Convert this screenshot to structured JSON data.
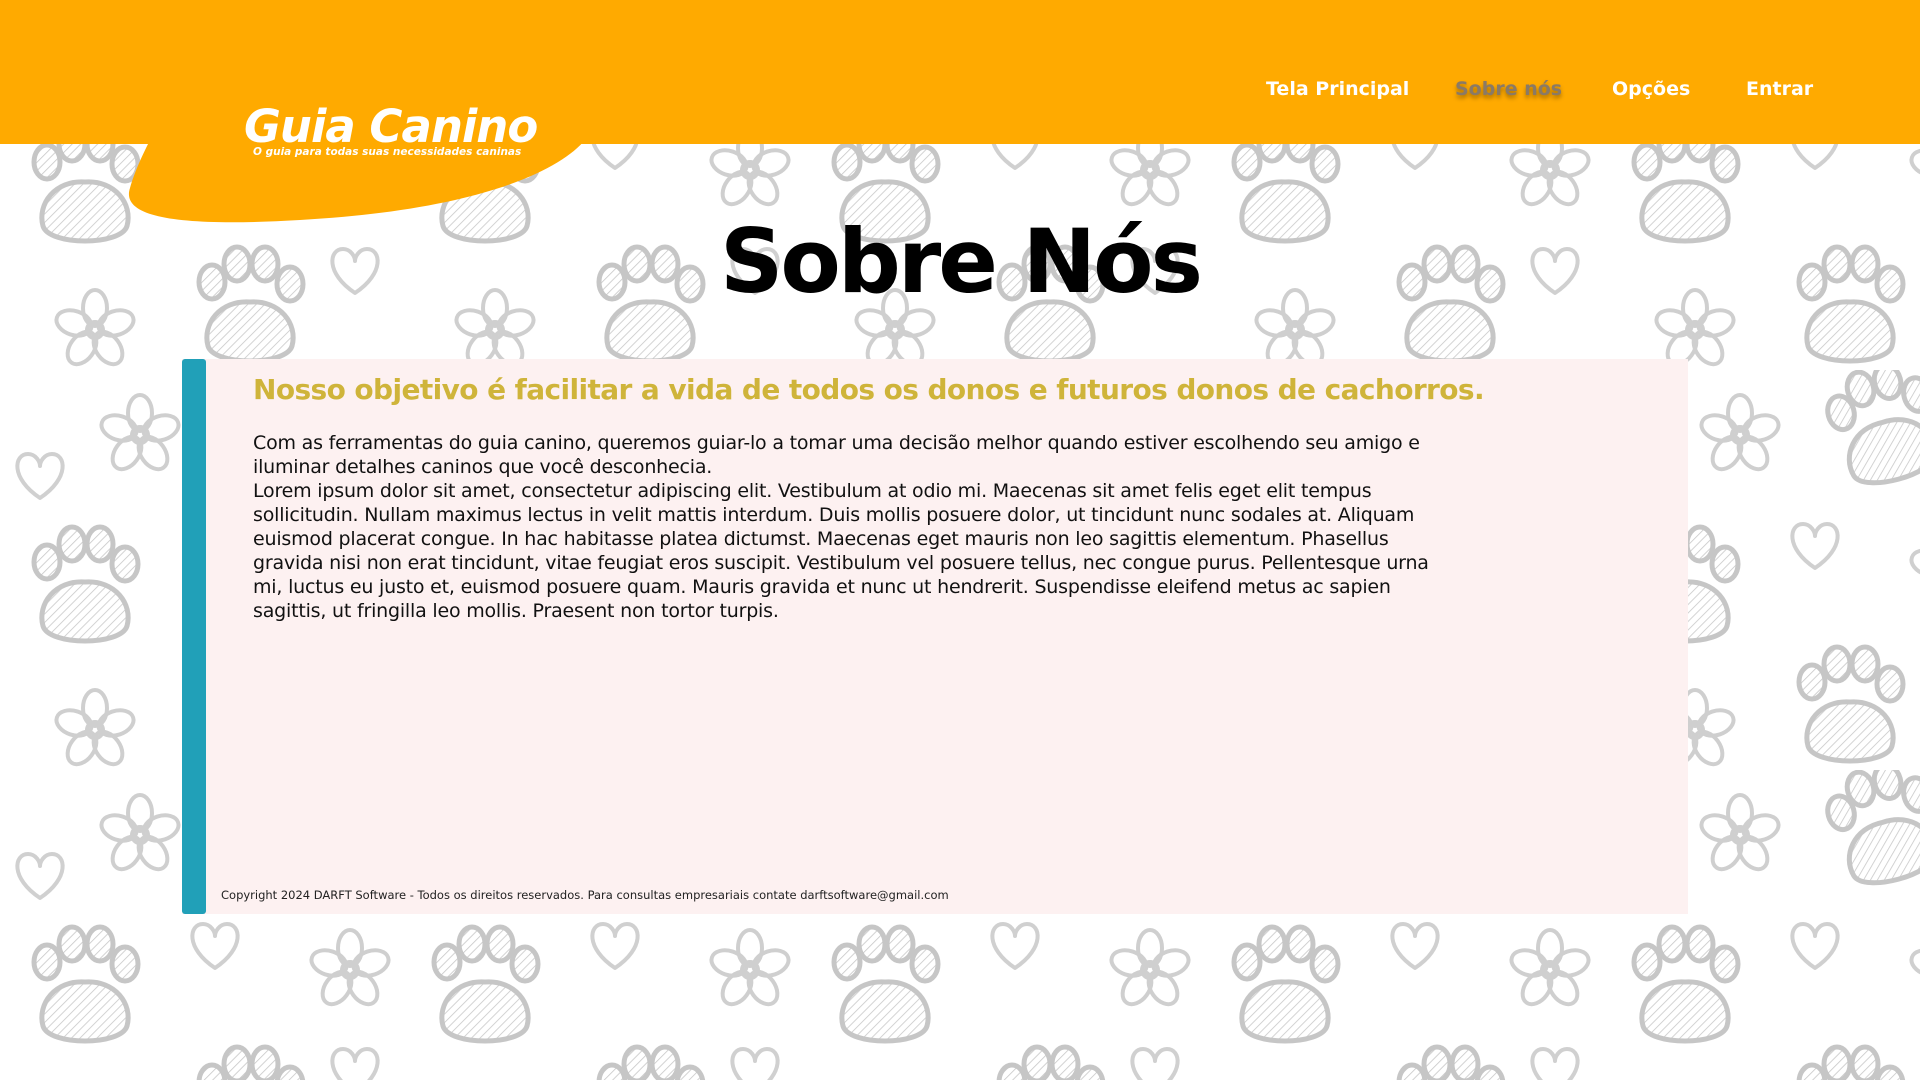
{
  "app": {
    "brand_color": "#FFAA00",
    "accent_bar_color": "#21A0B8",
    "card_background": "#FDF1F1",
    "heading_color": "#CFB43A"
  },
  "header": {
    "logo_title": "Guia Canino",
    "logo_subtitle": "O guia para todas suas necessidades caninas",
    "nav": [
      {
        "label": "Tela Principal",
        "active": false
      },
      {
        "label": "Sobre nós",
        "active": true
      },
      {
        "label": "Opções",
        "active": false
      },
      {
        "label": "Entrar",
        "active": false
      }
    ]
  },
  "main": {
    "title": "Sobre Nós",
    "card": {
      "heading": "Nosso objetivo é facilitar a vida de todos os donos e futuros donos de cachorros.",
      "paragraph_1": "Com as ferramentas do guia canino, queremos guiar-lo a tomar uma decisão melhor quando estiver escolhendo seu amigo e iluminar detalhes caninos que você desconhecia.",
      "paragraph_2": "Lorem ipsum dolor sit amet, consectetur adipiscing elit. Vestibulum at odio mi. Maecenas sit amet felis eget elit tempus sollicitudin. Nullam maximus lectus in velit mattis interdum. Duis mollis posuere dolor, ut tincidunt nunc sodales at. Aliquam euismod placerat congue. In hac habitasse platea dictumst. Maecenas eget mauris non leo sagittis elementum. Phasellus gravida nisi non erat tincidunt, vitae feugiat eros suscipit. Vestibulum vel posuere tellus, nec congue purus. Pellentesque urna mi, luctus eu justo et, euismod posuere quam. Mauris gravida et nunc ut hendrerit. Suspendisse eleifend metus ac sapien sagittis, ut fringilla leo mollis. Praesent non tortor turpis."
    },
    "footer": "Copyright 2024 DARFT Software - Todos os direitos reservados. Para consultas empresariais contate darftsoftware@gmail.com"
  },
  "background": {
    "pattern_icons": [
      "paw-icon",
      "flower-icon",
      "heart-icon"
    ]
  }
}
